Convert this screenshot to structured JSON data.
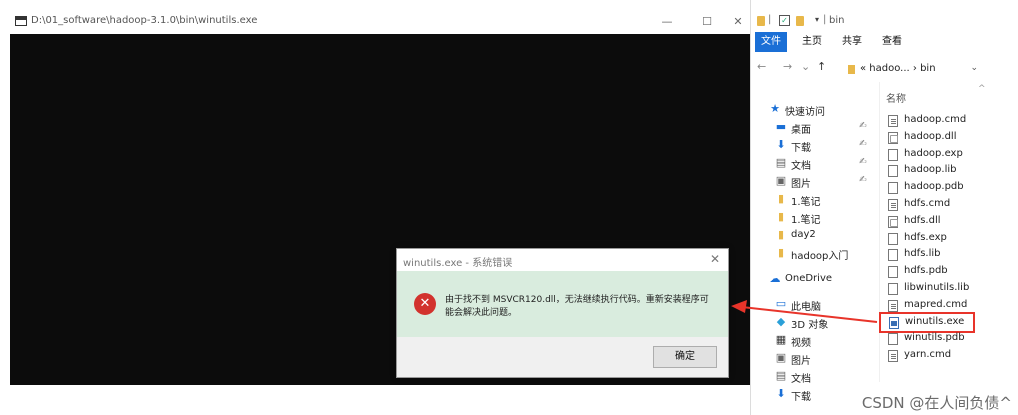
{
  "console": {
    "title": "D:\\01_software\\hadoop-3.1.0\\bin\\winutils.exe",
    "minimize": "—",
    "maximize": "☐",
    "close": "✕"
  },
  "explorer": {
    "titlebar": {
      "separator": "|",
      "dropdown": "▾",
      "path": "bin"
    },
    "ribbon": [
      "文件",
      "主页",
      "共享",
      "查看"
    ],
    "address": {
      "back": "←",
      "forward": "→",
      "recent": "⌄",
      "up": "↑",
      "breadcrumb": "« hadoo... › bin",
      "dropdown": "⌄"
    },
    "nav": [
      {
        "label": "快速访问",
        "icon": "star-icon",
        "glyph": "★",
        "color": "#1a6fd6",
        "pinned": false
      },
      {
        "label": "桌面",
        "icon": "desktop-icon",
        "glyph": "▬",
        "color": "#1a6fd6",
        "pinned": true
      },
      {
        "label": "下载",
        "icon": "download-icon",
        "glyph": "⬇",
        "color": "#1a6fd6",
        "pinned": true
      },
      {
        "label": "文档",
        "icon": "document-icon",
        "glyph": "▤",
        "color": "#666666",
        "pinned": true
      },
      {
        "label": "图片",
        "icon": "picture-icon",
        "glyph": "▣",
        "color": "#666666",
        "pinned": true
      },
      {
        "label": "1.笔记",
        "icon": "folder-icon",
        "glyph": "▮",
        "color": "#e8b84a",
        "pinned": false
      },
      {
        "label": "1.笔记",
        "icon": "folder-icon",
        "glyph": "▮",
        "color": "#e8b84a",
        "pinned": false
      },
      {
        "label": "day2",
        "icon": "folder-icon",
        "glyph": "▮",
        "color": "#e8b84a",
        "pinned": false
      },
      {
        "label": "hadoop入门",
        "icon": "folder-icon",
        "glyph": "▮",
        "color": "#e8b84a",
        "pinned": false
      },
      {
        "label": "OneDrive",
        "icon": "cloud-icon",
        "glyph": "☁",
        "color": "#1a6fd6",
        "pinned": false
      },
      {
        "label": "此电脑",
        "icon": "computer-icon",
        "glyph": "▭",
        "color": "#1a6fd6",
        "pinned": false
      },
      {
        "label": "3D 对象",
        "icon": "cube-icon",
        "glyph": "◆",
        "color": "#2aa0d8",
        "pinned": false
      },
      {
        "label": "视频",
        "icon": "video-icon",
        "glyph": "▦",
        "color": "#333333",
        "pinned": false
      },
      {
        "label": "图片",
        "icon": "picture-icon",
        "glyph": "▣",
        "color": "#666666",
        "pinned": false
      },
      {
        "label": "文档",
        "icon": "document-icon",
        "glyph": "▤",
        "color": "#666666",
        "pinned": false
      },
      {
        "label": "下载",
        "icon": "download-icon",
        "glyph": "⬇",
        "color": "#1a6fd6",
        "pinned": false
      }
    ],
    "pin_glyph": "📌",
    "column_header": "名称",
    "files": [
      {
        "name": "hadoop.cmd",
        "type": "cmd"
      },
      {
        "name": "hadoop.dll",
        "type": "dll"
      },
      {
        "name": "hadoop.exp",
        "type": "doc"
      },
      {
        "name": "hadoop.lib",
        "type": "doc"
      },
      {
        "name": "hadoop.pdb",
        "type": "doc"
      },
      {
        "name": "hdfs.cmd",
        "type": "cmd"
      },
      {
        "name": "hdfs.dll",
        "type": "dll"
      },
      {
        "name": "hdfs.exp",
        "type": "doc"
      },
      {
        "name": "hdfs.lib",
        "type": "doc"
      },
      {
        "name": "hdfs.pdb",
        "type": "doc"
      },
      {
        "name": "libwinutils.lib",
        "type": "doc"
      },
      {
        "name": "mapred.cmd",
        "type": "cmd"
      },
      {
        "name": "winutils.exe",
        "type": "exe",
        "highlighted": true
      },
      {
        "name": "winutils.pdb",
        "type": "doc"
      },
      {
        "name": "yarn.cmd",
        "type": "cmd"
      }
    ]
  },
  "dialog": {
    "title": "winutils.exe - 系统错误",
    "close": "✕",
    "error_glyph": "✕",
    "message": "由于找不到 MSVCR120.dll，无法继续执行代码。重新安装程序可能会解决此问题。",
    "ok_label": "确定"
  },
  "annotation": {
    "color": "#e8342a"
  },
  "watermark": "CSDN @在人间负债^"
}
